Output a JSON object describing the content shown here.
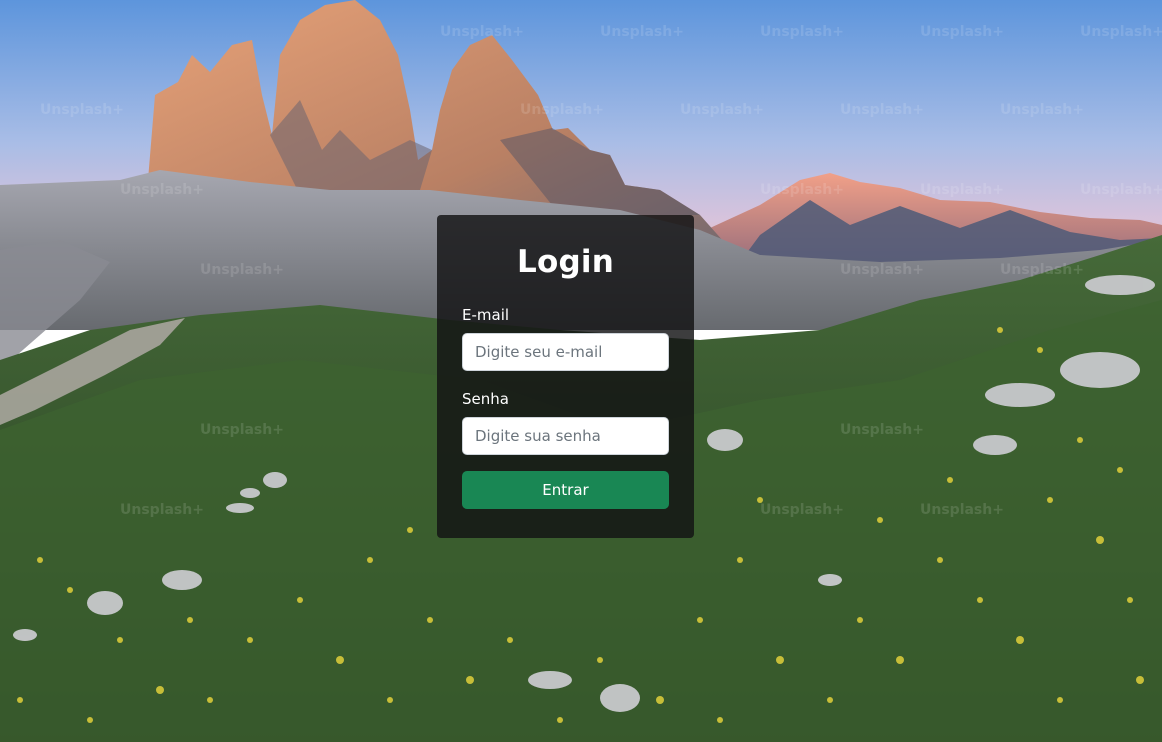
{
  "login": {
    "title": "Login",
    "email_label": "E-mail",
    "email_value": "",
    "email_placeholder": "Digite seu e-mail",
    "password_label": "Senha",
    "password_value": "",
    "password_placeholder": "Digite sua senha",
    "submit_label": "Entrar"
  },
  "background": {
    "watermark_text": "Unsplash+",
    "accent_color": "#198754"
  }
}
